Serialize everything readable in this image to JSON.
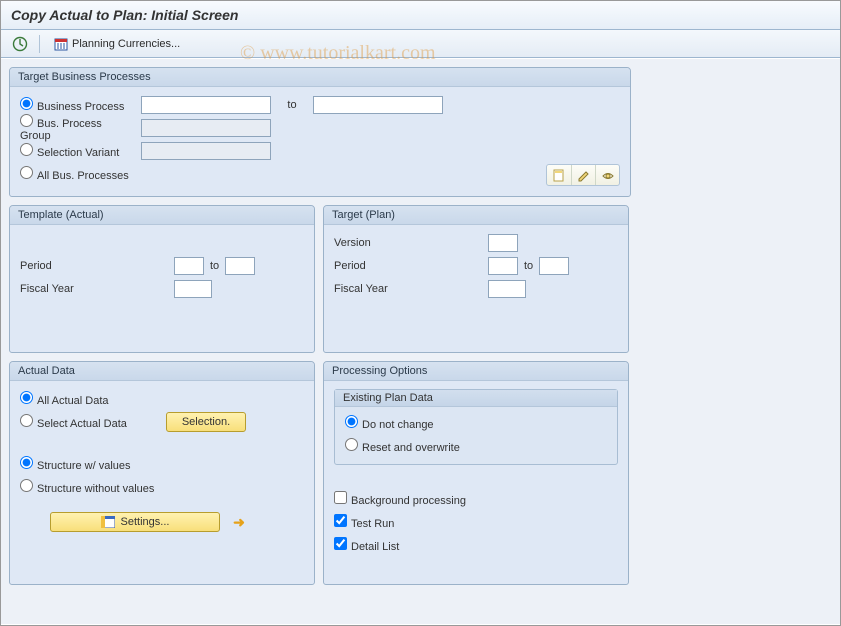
{
  "title": "Copy Actual to Plan: Initial Screen",
  "toolbar": {
    "planning_currencies": "Planning Currencies..."
  },
  "watermark": "©  www.tutorialkart.com",
  "group_target_bp": {
    "title": "Target Business Processes",
    "opt_business_process": "Business Process",
    "opt_bp_group": "Bus. Process Group",
    "opt_selection_variant": "Selection Variant",
    "opt_all_bp": "All Bus. Processes",
    "to": "to",
    "bp_from": "",
    "bp_to": "",
    "bpg_value": "",
    "sv_value": ""
  },
  "group_template": {
    "title": "Template (Actual)",
    "period_label": "Period",
    "to": "to",
    "fiscal_year_label": "Fiscal Year",
    "period_from": "",
    "period_to": "",
    "fiscal_year": ""
  },
  "group_target_plan": {
    "title": "Target (Plan)",
    "version_label": "Version",
    "period_label": "Period",
    "to": "to",
    "fiscal_year_label": "Fiscal Year",
    "version": "",
    "period_from": "",
    "period_to": "",
    "fiscal_year": ""
  },
  "group_actual_data": {
    "title": "Actual Data",
    "opt_all": "All Actual Data",
    "opt_select": "Select Actual Data",
    "selection_btn": "Selection.",
    "opt_struct_val": "Structure w/ values",
    "opt_struct_noval": "Structure without values",
    "settings_btn": "Settings..."
  },
  "group_processing": {
    "title": "Processing Options",
    "existing_title": "Existing Plan Data",
    "opt_do_not_change": "Do not change",
    "opt_reset": "Reset and overwrite",
    "cb_background": "Background processing",
    "cb_test_run": "Test Run",
    "cb_detail_list": "Detail List"
  }
}
